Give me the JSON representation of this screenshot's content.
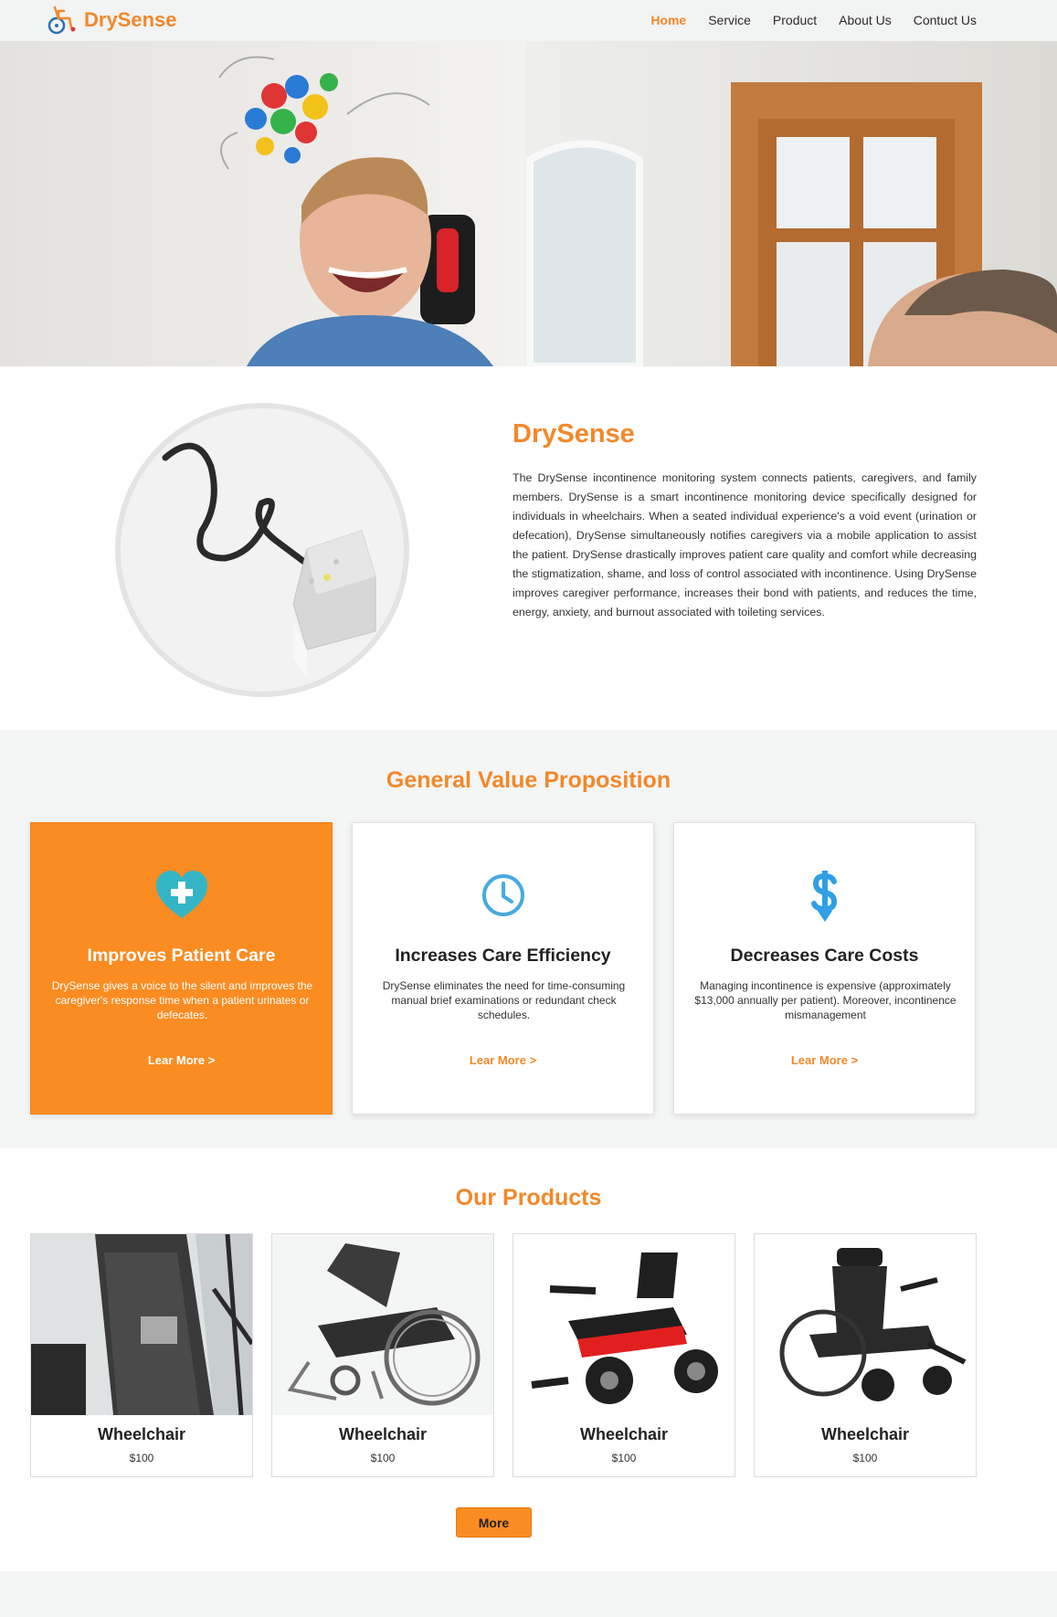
{
  "brand": {
    "name": "DrySense",
    "accent": "#f3882a"
  },
  "nav": {
    "items": [
      {
        "label": "Home"
      },
      {
        "label": "Service"
      },
      {
        "label": "Product"
      },
      {
        "label": "About Us"
      },
      {
        "label": "Contuct Us"
      }
    ]
  },
  "intro": {
    "title": "DrySense",
    "text": "The DrySense incontinence monitoring system connects patients, caregivers, and family members. DrySense is a smart incontinence monitoring device specifically designed for individuals in wheelchairs. When a seated individual experience's a void event (urination or defecation), DrySense simultaneously notifies caregivers via a mobile application to assist the patient. DrySense drastically improves patient care quality and comfort while decreasing the stigmatization, shame, and loss of control associated with incontinence. Using DrySense improves caregiver performance, increases their bond with patients, and reduces the time, energy, anxiety, and burnout associated with toileting services."
  },
  "value": {
    "title": "General Value Proposition",
    "cards": [
      {
        "icon": "heart-plus-icon",
        "title": "Improves Patient Care",
        "text": "DrySense gives a voice to the silent and improves the caregiver's response time when a patient urinates or defecates.",
        "link": "Lear More >"
      },
      {
        "icon": "clock-icon",
        "title": "Increases Care Efficiency",
        "text": "DrySense eliminates the need for time-consuming manual brief examinations or redundant check schedules.",
        "link": "Lear More >"
      },
      {
        "icon": "dollar-icon",
        "title": "Decreases Care Costs",
        "text": "Managing incontinence is expensive (approximately $13,000 annually per patient). Moreover, incontinence mismanagement",
        "link": "Lear More >"
      }
    ]
  },
  "products": {
    "title": "Our Products",
    "items": [
      {
        "name": "Wheelchair",
        "price": "$100"
      },
      {
        "name": "Wheelchair",
        "price": "$100"
      },
      {
        "name": "Wheelchair",
        "price": "$100"
      },
      {
        "name": "Wheelchair",
        "price": "$100"
      }
    ],
    "more_label": "More"
  }
}
